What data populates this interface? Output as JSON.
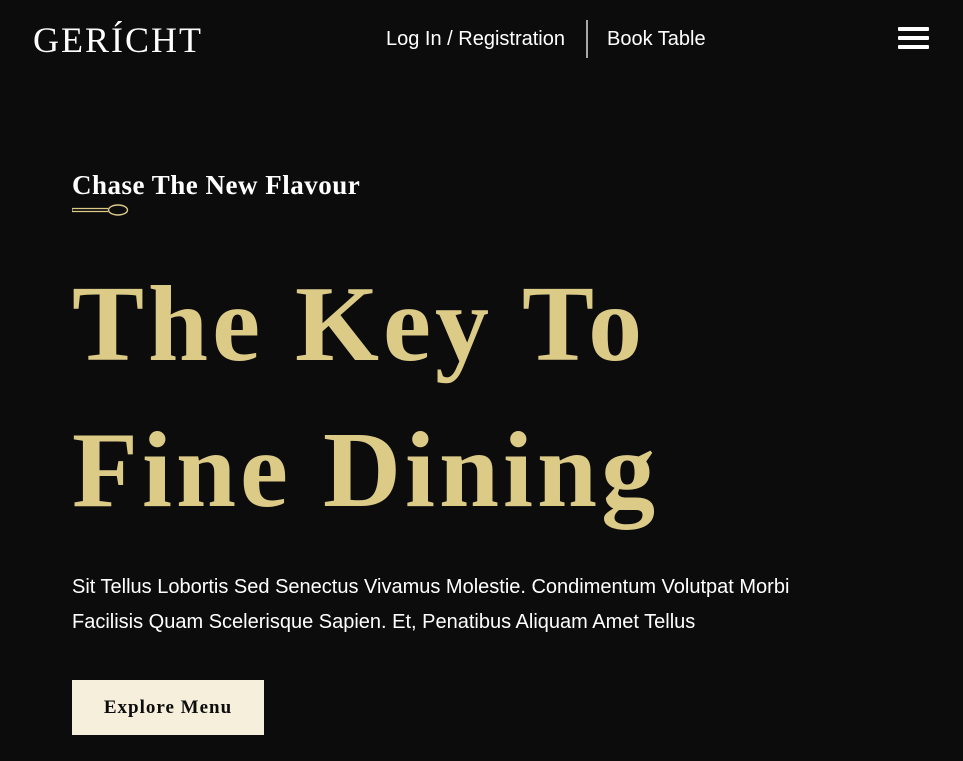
{
  "navbar": {
    "logo_text": "GERÍCHT",
    "login_label": "Log In / Registration",
    "book_label": "Book Table",
    "menu_icon": "hamburger-menu-icon"
  },
  "hero": {
    "subtitle": "Chase The New Flavour",
    "divider_icon": "spoon-icon",
    "headline_line1": "The Key To",
    "headline_line2": "Fine Dining",
    "description_line1": "Sit Tellus Lobortis Sed Senectus Vivamus Molestie. Condimentum Volutpat Morbi",
    "description_line2": "Facilisis Quam Scelerisque Sapien. Et, Penatibus Aliquam Amet Tellus",
    "cta_label": "Explore Menu"
  },
  "colors": {
    "background": "#0c0c0c",
    "gold": "#dcca87",
    "cream": "#f5efdb",
    "white": "#ffffff"
  }
}
